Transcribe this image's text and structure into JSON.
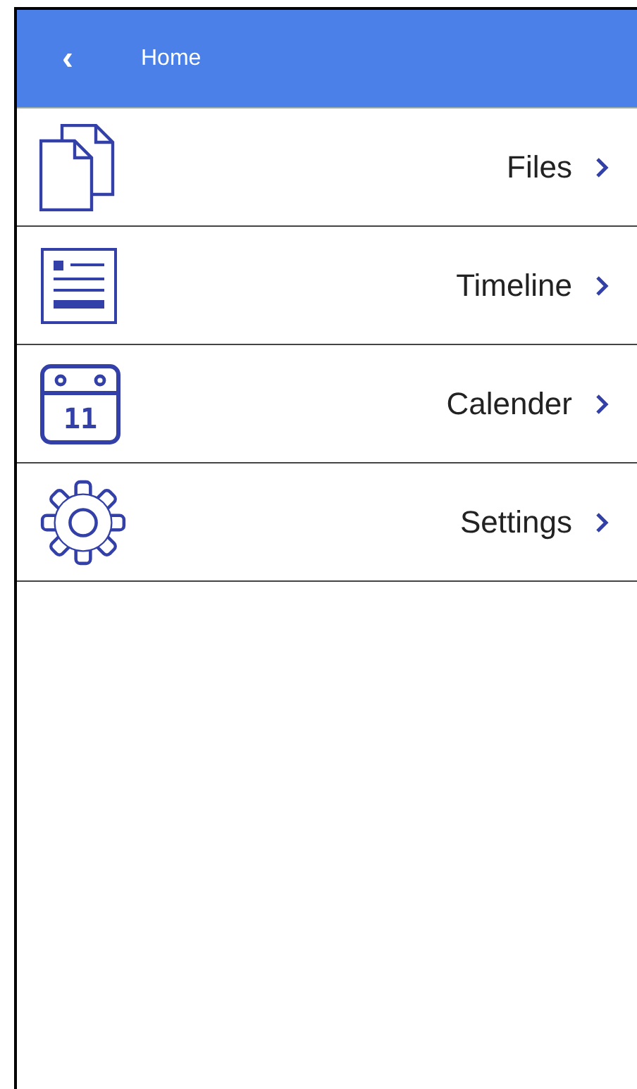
{
  "header": {
    "back": "‹",
    "title": "Home"
  },
  "items": [
    {
      "kind": "files",
      "label": "Files"
    },
    {
      "kind": "timeline",
      "label": "Timeline"
    },
    {
      "kind": "calendar",
      "label": "Calender",
      "icon_text": "11"
    },
    {
      "kind": "settings",
      "label": "Settings"
    }
  ]
}
